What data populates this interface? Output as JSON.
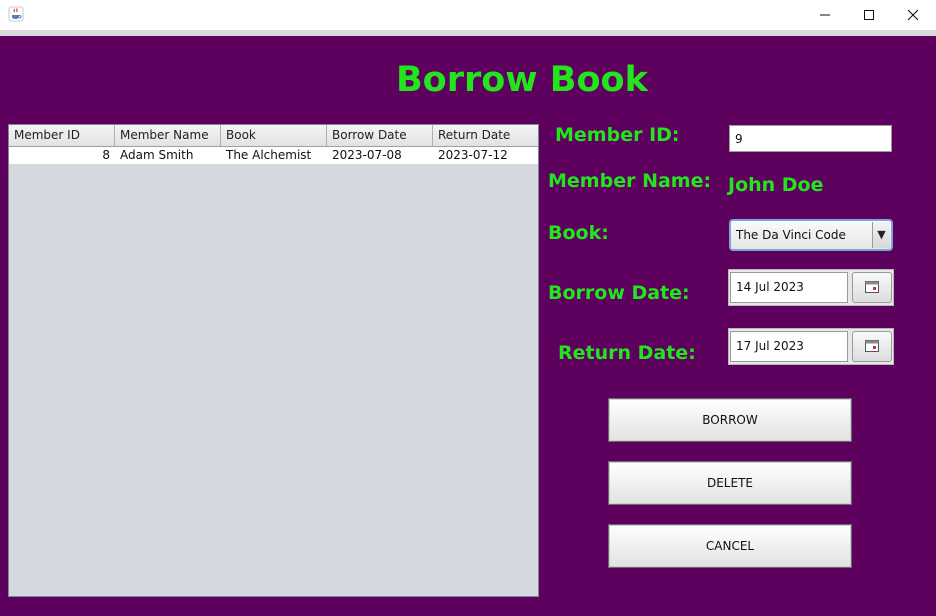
{
  "window": {
    "icon": "java-cup-icon",
    "controls": [
      "minimize-icon",
      "maximize-icon",
      "close-icon"
    ]
  },
  "page": {
    "title": "Borrow Book",
    "accent_color": "#22e61c",
    "background_color": "#5e005e"
  },
  "table": {
    "columns": [
      "Member ID",
      "Member Name",
      "Book",
      "Borrow Date",
      "Return Date"
    ],
    "rows": [
      [
        "8",
        "Adam Smith",
        "The Alchemist",
        "2023-07-08",
        "2023-07-12"
      ]
    ]
  },
  "form": {
    "member_id_label": "Member ID:",
    "member_id_value": "9",
    "member_name_label": "Member Name:",
    "member_name_value": "John Doe",
    "book_label": "Book:",
    "book_selected": "The Da Vinci Code",
    "borrow_date_label": "Borrow Date:",
    "borrow_date_value": "14 Jul 2023",
    "return_date_label": "Return Date:",
    "return_date_value": "17 Jul 2023",
    "calendar_icon": "calendar-icon"
  },
  "buttons": {
    "borrow": "BORROW",
    "delete": "DELETE",
    "cancel": "CANCEL"
  }
}
